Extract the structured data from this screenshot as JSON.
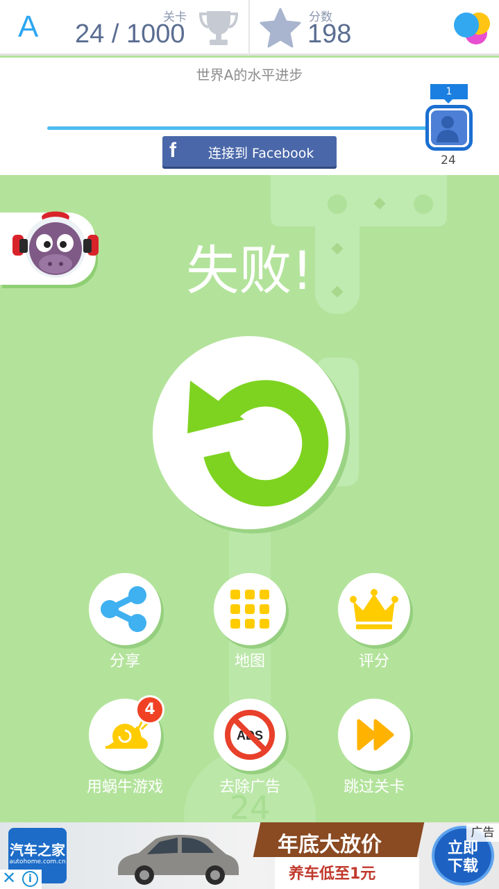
{
  "header": {
    "world_letter": "A",
    "level_label": "关卡",
    "level_value": "24 / 1000",
    "score_label": "分数",
    "score_value": "198",
    "trophy_icon": "trophy-icon",
    "star_icon": "star-icon",
    "menu_icon": "app-logo-icon"
  },
  "progress": {
    "title": "世界A的水平进步",
    "facebook_label": "连接到 Facebook",
    "rank": "1",
    "player_level": "24"
  },
  "game": {
    "result_title": "失败!",
    "bg_level_number": "24"
  },
  "buttons": [
    {
      "name": "share",
      "label": "分享",
      "icon": "share-icon"
    },
    {
      "name": "map",
      "label": "地图",
      "icon": "grid-icon"
    },
    {
      "name": "rate",
      "label": "评分",
      "icon": "crown-icon"
    },
    {
      "name": "snail-games",
      "label": "用蜗牛游戏",
      "icon": "snail-icon",
      "badge": "4"
    },
    {
      "name": "remove-ads",
      "label": "去除广告",
      "icon": "no-ads-icon",
      "icon_text": "ADS"
    },
    {
      "name": "skip-level",
      "label": "跳过关卡",
      "icon": "fast-forward-icon"
    }
  ],
  "ad": {
    "logo_title": "汽车之家",
    "logo_sub": "autohome.com.cn",
    "headline": "年底大放价",
    "subline": "养车低至1元",
    "cta": "立即下载",
    "cta_line1": "立即",
    "cta_line2": "下载",
    "tag": "广告",
    "close": "✕",
    "info": "i"
  },
  "colors": {
    "accent_blue": "#2ea7f2",
    "game_bg": "#b3e39b",
    "retry_green": "#7ed321",
    "icon_yellow": "#ffcc00",
    "share_blue": "#3fb0f0",
    "badge_red": "#f04124"
  }
}
